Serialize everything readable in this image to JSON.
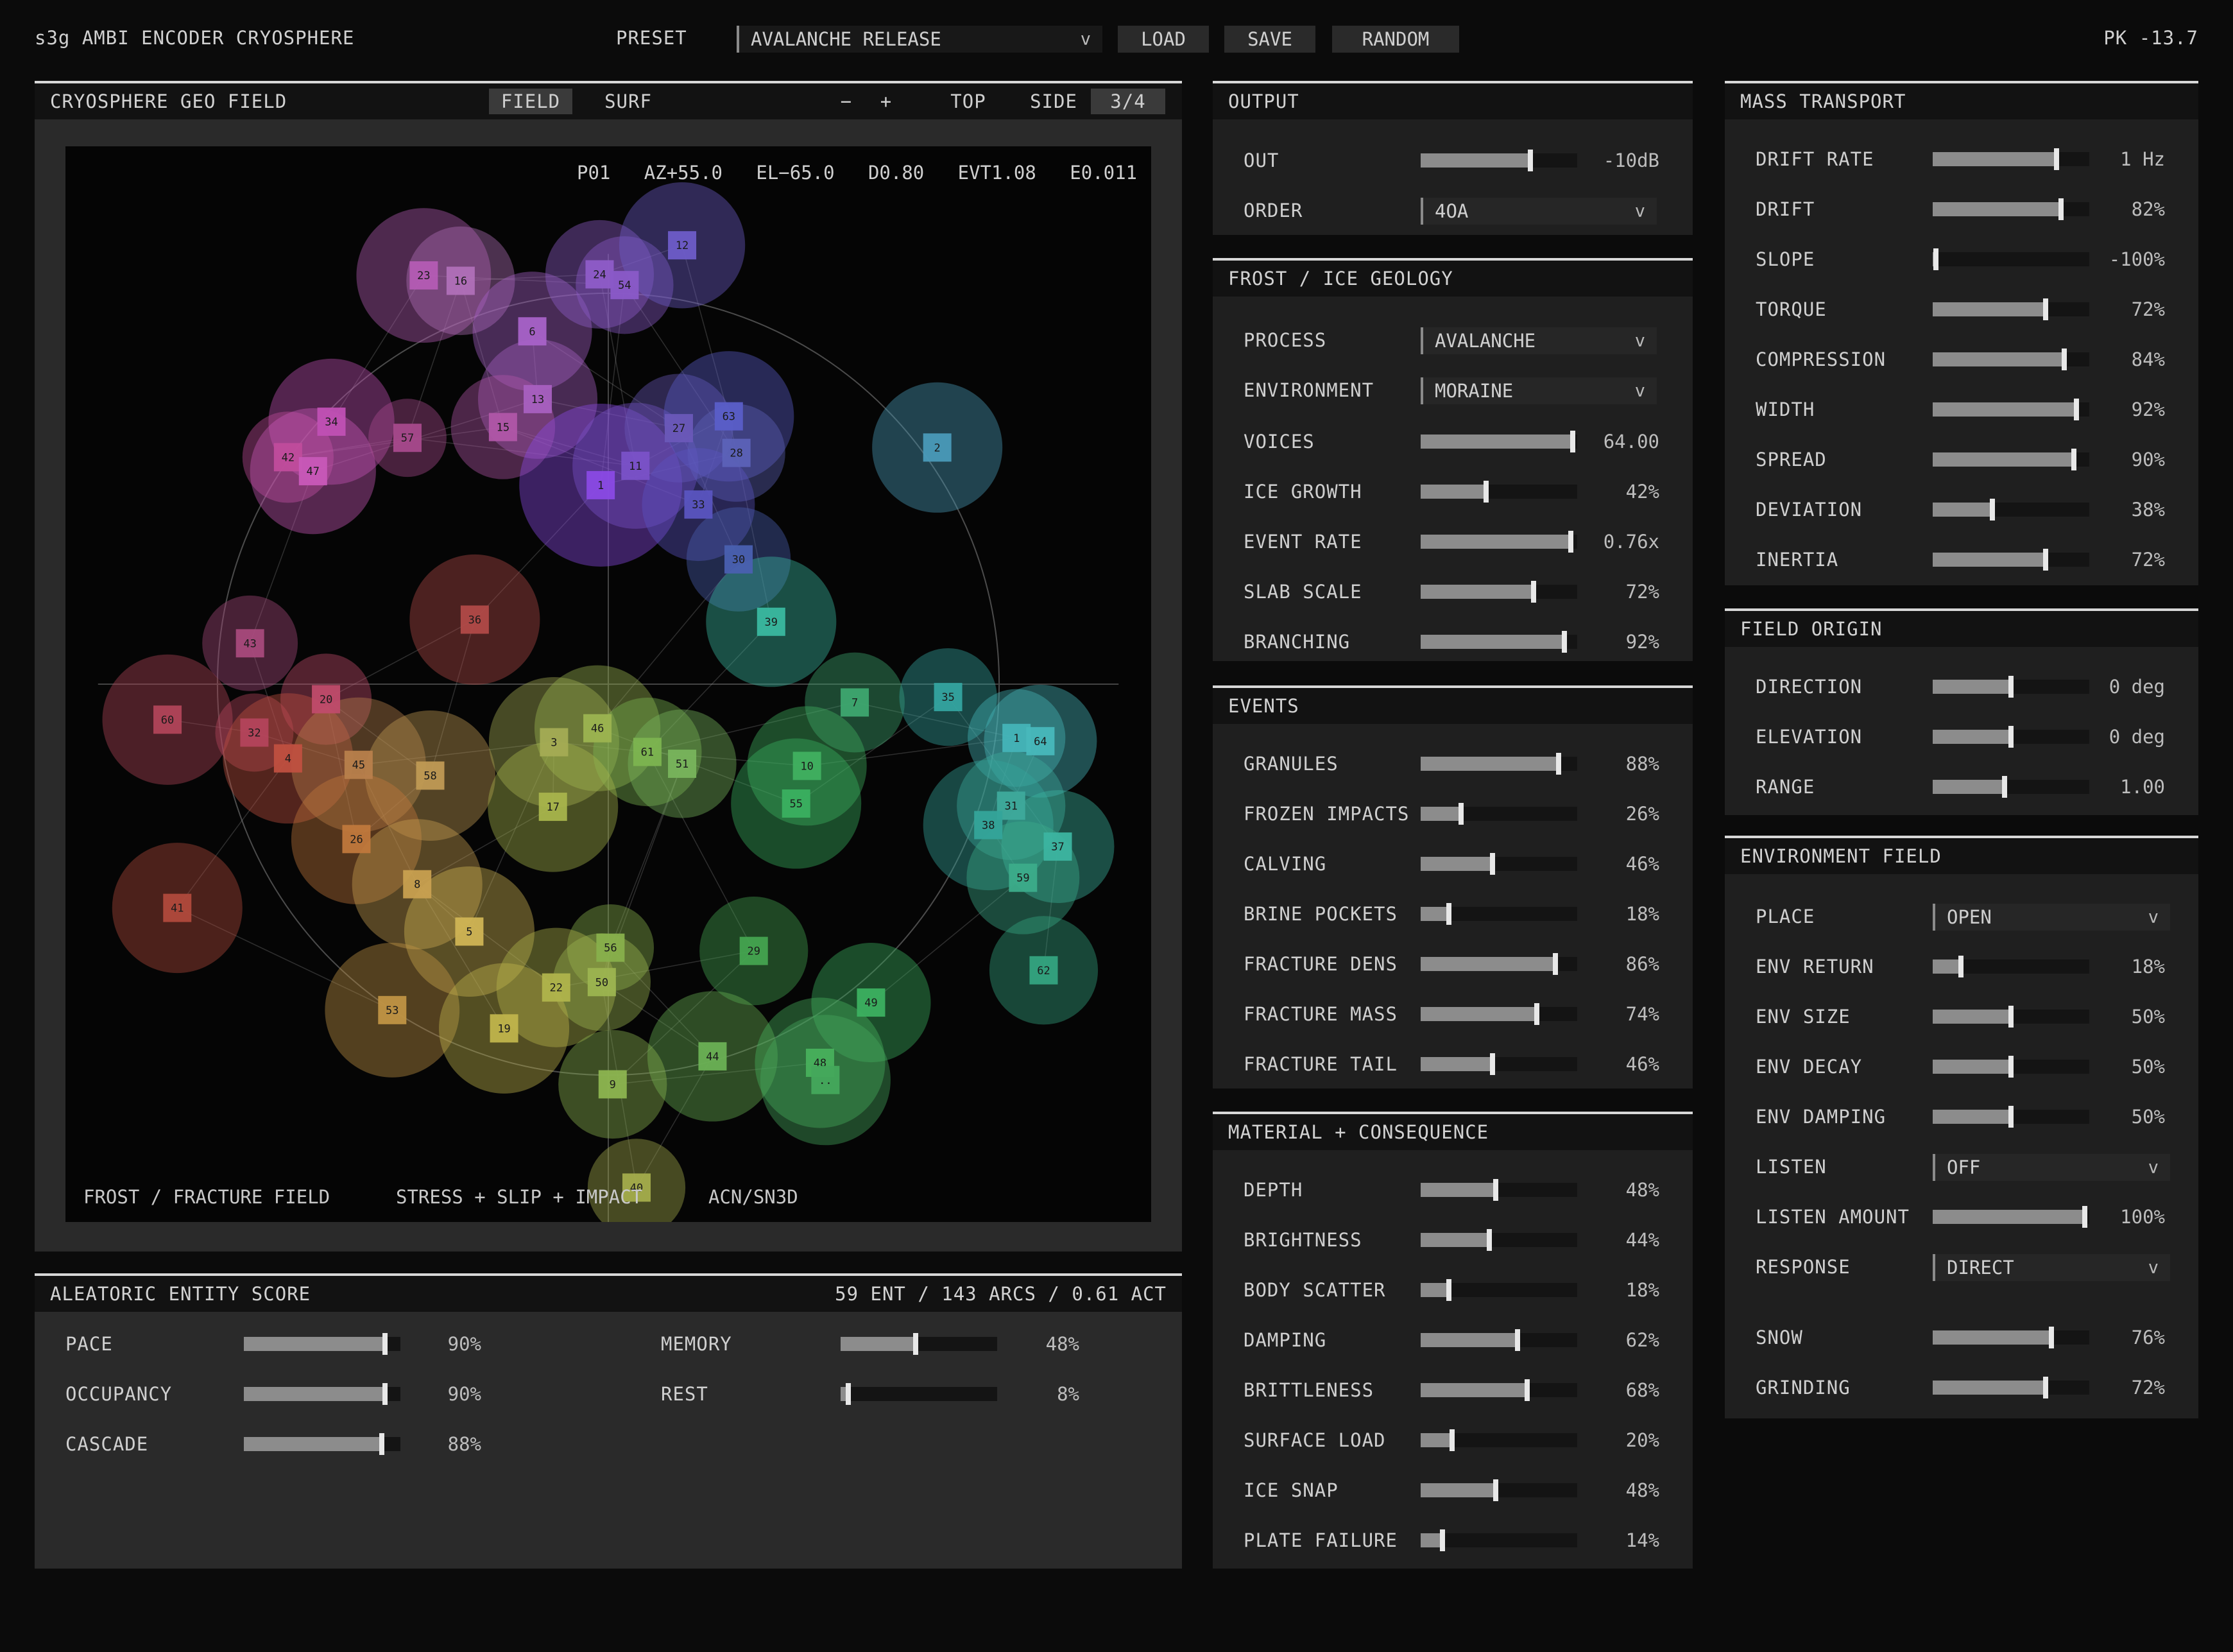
{
  "header": {
    "app_title": "s3g AMBI ENCODER CRYOSPHERE",
    "preset_label": "PRESET",
    "preset_value": "AVALANCHE RELEASE",
    "load": "LOAD",
    "save": "SAVE",
    "random": "RANDOM",
    "peak": "PK -13.7"
  },
  "field": {
    "title": "CRYOSPHERE GEO FIELD",
    "tab_field": "FIELD",
    "tab_surf": "SURF",
    "zoom_minus": "−",
    "zoom_plus": "+",
    "view_top": "TOP",
    "view_side": "SIDE",
    "view_34": "3/4",
    "readout": "P01   AZ+55.0   EL−65.0   D0.80   EVT1.08   E0.011",
    "footer_1": "FROST / FRACTURE FIELD",
    "footer_2": "STRESS + SLIP + IMPACT",
    "footer_3": "ACN/SN3D",
    "nodes": [
      {
        "id": "23",
        "nx": 0.33,
        "ny": 0.12,
        "r": 0.062,
        "color": "#b45cb4"
      },
      {
        "id": "16",
        "nx": 0.364,
        "ny": 0.125,
        "r": 0.05,
        "color": "#b070b8"
      },
      {
        "id": "6",
        "nx": 0.43,
        "ny": 0.172,
        "r": 0.055,
        "color": "#a862c8"
      },
      {
        "id": "24",
        "nx": 0.492,
        "ny": 0.119,
        "r": 0.05,
        "color": "#8e5cc8"
      },
      {
        "id": "54",
        "nx": 0.515,
        "ny": 0.129,
        "r": 0.045,
        "color": "#8a5ac8"
      },
      {
        "id": "12",
        "nx": 0.568,
        "ny": 0.092,
        "r": 0.058,
        "color": "#6e5cc8"
      },
      {
        "id": "13",
        "nx": 0.435,
        "ny": 0.235,
        "r": 0.055,
        "color": "#a860c0"
      },
      {
        "id": "15",
        "nx": 0.403,
        "ny": 0.261,
        "r": 0.048,
        "color": "#b056a8"
      },
      {
        "id": "34",
        "nx": 0.245,
        "ny": 0.256,
        "r": 0.058,
        "color": "#c050b4"
      },
      {
        "id": "42",
        "nx": 0.205,
        "ny": 0.289,
        "r": 0.042,
        "color": "#c04c9c"
      },
      {
        "id": "47",
        "nx": 0.228,
        "ny": 0.302,
        "r": 0.058,
        "color": "#c858b8"
      },
      {
        "id": "57",
        "nx": 0.315,
        "ny": 0.271,
        "r": 0.036,
        "color": "#a84a8c"
      },
      {
        "id": "1",
        "nx": 0.493,
        "ny": 0.315,
        "r": 0.075,
        "color": "#8a4ae4"
      },
      {
        "id": "11",
        "nx": 0.525,
        "ny": 0.297,
        "r": 0.058,
        "color": "#7a52c8"
      },
      {
        "id": "27",
        "nx": 0.565,
        "ny": 0.262,
        "r": 0.05,
        "color": "#6a58b8"
      },
      {
        "id": "63",
        "nx": 0.611,
        "ny": 0.251,
        "r": 0.06,
        "color": "#5a5ec8"
      },
      {
        "id": "28",
        "nx": 0.618,
        "ny": 0.285,
        "r": 0.045,
        "color": "#5c62b8"
      },
      {
        "id": "33",
        "nx": 0.583,
        "ny": 0.333,
        "r": 0.052,
        "color": "#5a54c0"
      },
      {
        "id": "30",
        "nx": 0.62,
        "ny": 0.384,
        "r": 0.048,
        "color": "#4a60b0"
      },
      {
        "id": "2",
        "nx": 0.803,
        "ny": 0.28,
        "r": 0.06,
        "color": "#4a9ab8"
      },
      {
        "id": "36",
        "nx": 0.377,
        "ny": 0.44,
        "r": 0.06,
        "color": "#b04a48"
      },
      {
        "id": "39",
        "nx": 0.65,
        "ny": 0.442,
        "r": 0.06,
        "color": "#3ab8a0"
      },
      {
        "id": "43",
        "nx": 0.17,
        "ny": 0.462,
        "r": 0.044,
        "color": "#a84a7c"
      },
      {
        "id": "60",
        "nx": 0.094,
        "ny": 0.533,
        "r": 0.06,
        "color": "#b04458"
      },
      {
        "id": "20",
        "nx": 0.24,
        "ny": 0.514,
        "r": 0.042,
        "color": "#c04c6c"
      },
      {
        "id": "32",
        "nx": 0.174,
        "ny": 0.545,
        "r": 0.036,
        "color": "#b4445c"
      },
      {
        "id": "4",
        "nx": 0.205,
        "ny": 0.569,
        "r": 0.06,
        "color": "#c05040"
      },
      {
        "id": "45",
        "nx": 0.27,
        "ny": 0.575,
        "r": 0.062,
        "color": "#b8804c"
      },
      {
        "id": "58",
        "nx": 0.336,
        "ny": 0.585,
        "r": 0.06,
        "color": "#c09a54"
      },
      {
        "id": "3",
        "nx": 0.45,
        "ny": 0.554,
        "r": 0.06,
        "color": "#a4ac54"
      },
      {
        "id": "46",
        "nx": 0.49,
        "ny": 0.541,
        "r": 0.058,
        "color": "#9cb450"
      },
      {
        "id": "61",
        "nx": 0.536,
        "ny": 0.563,
        "r": 0.05,
        "color": "#7cb450"
      },
      {
        "id": "51",
        "nx": 0.568,
        "ny": 0.574,
        "r": 0.05,
        "color": "#78b45c"
      },
      {
        "id": "7",
        "nx": 0.727,
        "ny": 0.517,
        "r": 0.046,
        "color": "#3ea870"
      },
      {
        "id": "35",
        "nx": 0.813,
        "ny": 0.512,
        "r": 0.045,
        "color": "#34a4a0"
      },
      {
        "id": "1",
        "nx": 0.876,
        "ny": 0.55,
        "r": 0.045,
        "color": "#44b4b8"
      },
      {
        "id": "64",
        "nx": 0.898,
        "ny": 0.553,
        "r": 0.052,
        "color": "#48b8bc"
      },
      {
        "id": "10",
        "nx": 0.683,
        "ny": 0.576,
        "r": 0.055,
        "color": "#40b060"
      },
      {
        "id": "55",
        "nx": 0.673,
        "ny": 0.611,
        "r": 0.06,
        "color": "#3ab060"
      },
      {
        "id": "17",
        "nx": 0.449,
        "ny": 0.614,
        "r": 0.06,
        "color": "#a8b44c"
      },
      {
        "id": "31",
        "nx": 0.871,
        "ny": 0.613,
        "r": 0.05,
        "color": "#3eaa9c"
      },
      {
        "id": "38",
        "nx": 0.85,
        "ny": 0.631,
        "r": 0.06,
        "color": "#34a49a"
      },
      {
        "id": "37",
        "nx": 0.914,
        "ny": 0.651,
        "r": 0.052,
        "color": "#3cb4a0"
      },
      {
        "id": "59",
        "nx": 0.882,
        "ny": 0.68,
        "r": 0.052,
        "color": "#3cac8a"
      },
      {
        "id": "26",
        "nx": 0.268,
        "ny": 0.644,
        "r": 0.06,
        "color": "#c0783c"
      },
      {
        "id": "8",
        "nx": 0.324,
        "ny": 0.686,
        "r": 0.06,
        "color": "#c8a050"
      },
      {
        "id": "41",
        "nx": 0.103,
        "ny": 0.708,
        "r": 0.06,
        "color": "#b04a3c"
      },
      {
        "id": "5",
        "nx": 0.372,
        "ny": 0.73,
        "r": 0.06,
        "color": "#d0b454"
      },
      {
        "id": "56",
        "nx": 0.502,
        "ny": 0.745,
        "r": 0.04,
        "color": "#88b04c"
      },
      {
        "id": "29",
        "nx": 0.634,
        "ny": 0.748,
        "r": 0.05,
        "color": "#44a450"
      },
      {
        "id": "62",
        "nx": 0.901,
        "ny": 0.766,
        "r": 0.05,
        "color": "#34a480"
      },
      {
        "id": "22",
        "nx": 0.452,
        "ny": 0.782,
        "r": 0.055,
        "color": "#b0b44c"
      },
      {
        "id": "50",
        "nx": 0.494,
        "ny": 0.777,
        "r": 0.045,
        "color": "#9cb450"
      },
      {
        "id": "49",
        "nx": 0.742,
        "ny": 0.796,
        "r": 0.055,
        "color": "#3cb060"
      },
      {
        "id": "53",
        "nx": 0.301,
        "ny": 0.803,
        "r": 0.062,
        "color": "#c09444"
      },
      {
        "id": "19",
        "nx": 0.404,
        "ny": 0.82,
        "r": 0.06,
        "color": "#c0b44c"
      },
      {
        "id": "44",
        "nx": 0.596,
        "ny": 0.846,
        "r": 0.06,
        "color": "#6ab054"
      },
      {
        "id": "48",
        "nx": 0.695,
        "ny": 0.852,
        "r": 0.06,
        "color": "#48b05c"
      },
      {
        "id": "..",
        "nx": 0.7,
        "ny": 0.868,
        "r": 0.06,
        "color": "#44a85c"
      },
      {
        "id": "9",
        "nx": 0.504,
        "ny": 0.872,
        "r": 0.05,
        "color": "#8cb450"
      },
      {
        "id": "40",
        "nx": 0.526,
        "ny": 0.968,
        "r": 0.045,
        "color": "#a4ac4c"
      }
    ]
  },
  "score": {
    "title": "ALEATORIC ENTITY SCORE",
    "summary": "59 ENT / 143 ARCS / 0.61 ACT",
    "left": [
      {
        "label": "PACE",
        "value": "90%",
        "level": 0.9
      },
      {
        "label": "OCCUPANCY",
        "value": "90%",
        "level": 0.9
      },
      {
        "label": "CASCADE",
        "value": "88%",
        "level": 0.88
      }
    ],
    "right": [
      {
        "label": "MEMORY",
        "value": "48%",
        "level": 0.48
      },
      {
        "label": "REST",
        "value": "8%",
        "level": 0.05
      }
    ]
  },
  "output": {
    "title": "OUTPUT",
    "out_label": "OUT",
    "out_value": "-10dB",
    "out_level": 0.7,
    "order_label": "ORDER",
    "order_value": "4OA"
  },
  "frost": {
    "title": "FROST / ICE GEOLOGY",
    "process_label": "PROCESS",
    "process_value": "AVALANCHE",
    "environment_label": "ENVIRONMENT",
    "environment_value": "MORAINE",
    "sliders": [
      {
        "label": "VOICES",
        "value": "64.00",
        "level": 0.97
      },
      {
        "label": "ICE GROWTH",
        "value": "42%",
        "level": 0.42
      },
      {
        "label": "EVENT RATE",
        "value": "0.76x",
        "level": 0.96
      },
      {
        "label": "SLAB SCALE",
        "value": "72%",
        "level": 0.72
      },
      {
        "label": "BRANCHING",
        "value": "92%",
        "level": 0.92
      }
    ]
  },
  "events": {
    "title": "EVENTS",
    "sliders": [
      {
        "label": "GRANULES",
        "value": "88%",
        "level": 0.88
      },
      {
        "label": "FROZEN IMPACTS",
        "value": "26%",
        "level": 0.26
      },
      {
        "label": "CALVING",
        "value": "46%",
        "level": 0.46
      },
      {
        "label": "BRINE POCKETS",
        "value": "18%",
        "level": 0.18
      },
      {
        "label": "FRACTURE DENS",
        "value": "86%",
        "level": 0.86
      },
      {
        "label": "FRACTURE MASS",
        "value": "74%",
        "level": 0.74
      },
      {
        "label": "FRACTURE TAIL",
        "value": "46%",
        "level": 0.46
      }
    ]
  },
  "material": {
    "title": "MATERIAL + CONSEQUENCE",
    "sliders": [
      {
        "label": "DEPTH",
        "value": "48%",
        "level": 0.48
      },
      {
        "label": "BRIGHTNESS",
        "value": "44%",
        "level": 0.44
      },
      {
        "label": "BODY SCATTER",
        "value": "18%",
        "level": 0.18
      },
      {
        "label": "DAMPING",
        "value": "62%",
        "level": 0.62
      },
      {
        "label": "BRITTLENESS",
        "value": "68%",
        "level": 0.68
      },
      {
        "label": "SURFACE LOAD",
        "value": "20%",
        "level": 0.2
      },
      {
        "label": "ICE SNAP",
        "value": "48%",
        "level": 0.48
      },
      {
        "label": "PLATE FAILURE",
        "value": "14%",
        "level": 0.14
      }
    ]
  },
  "mass": {
    "title": "MASS TRANSPORT",
    "sliders": [
      {
        "label": "DRIFT RATE",
        "value": "1 Hz",
        "level": 0.79
      },
      {
        "label": "DRIFT",
        "value": "82%",
        "level": 0.82
      },
      {
        "label": "SLOPE",
        "value": "-100%",
        "level": 0.02
      },
      {
        "label": "TORQUE",
        "value": "72%",
        "level": 0.72
      },
      {
        "label": "COMPRESSION",
        "value": "84%",
        "level": 0.84
      },
      {
        "label": "WIDTH",
        "value": "92%",
        "level": 0.92
      },
      {
        "label": "SPREAD",
        "value": "90%",
        "level": 0.9
      },
      {
        "label": "DEVIATION",
        "value": "38%",
        "level": 0.38
      },
      {
        "label": "INERTIA",
        "value": "72%",
        "level": 0.72
      }
    ]
  },
  "origin": {
    "title": "FIELD ORIGIN",
    "sliders": [
      {
        "label": "DIRECTION",
        "value": "0 deg",
        "level": 0.5
      },
      {
        "label": "ELEVATION",
        "value": "0 deg",
        "level": 0.5
      },
      {
        "label": "RANGE",
        "value": "1.00",
        "level": 0.46
      }
    ]
  },
  "env": {
    "title": "ENVIRONMENT FIELD",
    "place_label": "PLACE",
    "place_value": "OPEN",
    "listen_label": "LISTEN",
    "listen_value": "OFF",
    "response_label": "RESPONSE",
    "response_value": "DIRECT",
    "sliders_a": [
      {
        "label": "ENV RETURN",
        "value": "18%",
        "level": 0.18
      },
      {
        "label": "ENV SIZE",
        "value": "50%",
        "level": 0.5
      },
      {
        "label": "ENV DECAY",
        "value": "50%",
        "level": 0.5
      },
      {
        "label": "ENV DAMPING",
        "value": "50%",
        "level": 0.5
      }
    ],
    "listen_amount": {
      "label": "LISTEN AMOUNT",
      "value": "100%",
      "level": 0.97
    },
    "sliders_b": [
      {
        "label": "SNOW",
        "value": "76%",
        "level": 0.76
      },
      {
        "label": "GRINDING",
        "value": "72%",
        "level": 0.72
      }
    ]
  }
}
